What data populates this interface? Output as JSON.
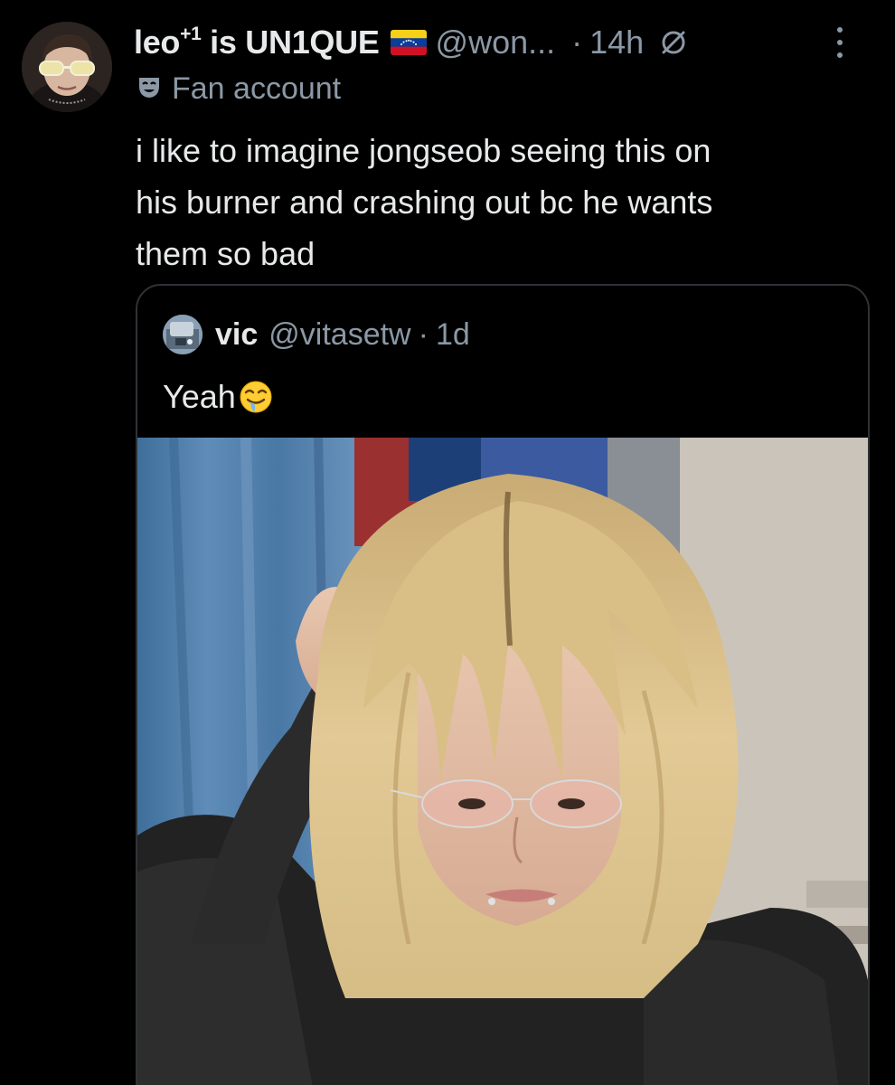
{
  "author": {
    "display_name": "leo",
    "superscript": "+1",
    "display_name_rest": " is UN1QUE",
    "flag": "venezuela-flag",
    "handle": "@won...",
    "separator": "·",
    "time": "14h",
    "label_icon": "theater-mask-icon",
    "label": "Fan account"
  },
  "tweet": {
    "lines": [
      "i like to imagine jongseob seeing this on",
      "his burner and crashing out bc he wants",
      "them so bad"
    ]
  },
  "quote": {
    "name": "vic",
    "handle": "@vitasetw",
    "separator": "·",
    "time": "1d",
    "text": "Yeah",
    "emoji": "drooling-face-emoji",
    "media": "photo"
  },
  "colors": {
    "background": "#000000",
    "text_primary": "#e7e9ea",
    "text_secondary": "#8b98a5",
    "border": "#2f3336"
  }
}
